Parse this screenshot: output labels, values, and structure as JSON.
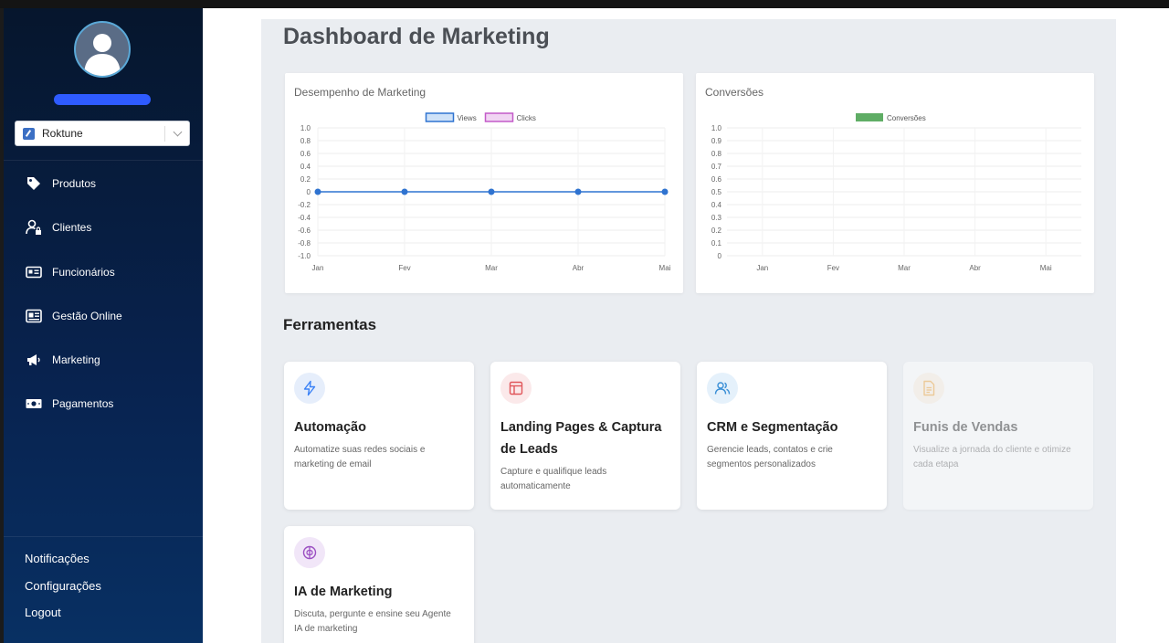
{
  "sidebar": {
    "store_select": {
      "value": "Roktune"
    },
    "nav": [
      {
        "label": "Produtos",
        "icon": "tag-icon"
      },
      {
        "label": "Clientes",
        "icon": "user-lock-icon"
      },
      {
        "label": "Funcionários",
        "icon": "id-card-icon"
      },
      {
        "label": "Gestão Online",
        "icon": "newspaper-icon"
      },
      {
        "label": "Marketing",
        "icon": "megaphone-icon"
      },
      {
        "label": "Pagamentos",
        "icon": "money-bill-icon"
      }
    ],
    "bottom": [
      {
        "label": "Notificações"
      },
      {
        "label": "Configurações"
      },
      {
        "label": "Logout"
      }
    ]
  },
  "main": {
    "title": "Dashboard de Marketing",
    "tools_title": "Ferramentas",
    "tools": [
      {
        "title": "Automação",
        "description": "Automatize suas redes sociais e marketing de email",
        "icon": "lightning-icon",
        "icon_color": "#3b82f6",
        "icon_bg": "#e6eefb",
        "enabled": true
      },
      {
        "title": "Landing Pages & Captura de Leads",
        "description": "Capture e qualifique leads automaticamente",
        "icon": "layout-icon",
        "icon_color": "#e0565b",
        "icon_bg": "#fbe9ea",
        "enabled": true
      },
      {
        "title": "CRM e Segmentação",
        "description": "Gerencie leads, contatos e crie segmentos personalizados",
        "icon": "users-icon",
        "icon_color": "#3a8fd6",
        "icon_bg": "#e5f1fb",
        "enabled": true
      },
      {
        "title": "Funis de Vendas",
        "description": "Visualize a jornada do cliente e otimize cada etapa",
        "icon": "document-icon",
        "icon_color": "#f0a030",
        "icon_bg": "#fdf1e0",
        "enabled": false
      },
      {
        "title": "IA de Marketing",
        "description": "Discuta, pergunte e ensine seu Agente IA de marketing",
        "icon": "brain-icon",
        "icon_color": "#9b4fc2",
        "icon_bg": "#f1e6f8",
        "enabled": true
      }
    ]
  },
  "chart_data": [
    {
      "type": "line",
      "title": "Desempenho de Marketing",
      "categories": [
        "Jan",
        "Fev",
        "Mar",
        "Abr",
        "Mai"
      ],
      "series": [
        {
          "name": "Views",
          "values": [
            0,
            0,
            0,
            0,
            0
          ],
          "color": "#2f73d0"
        },
        {
          "name": "Clicks",
          "values": [
            null,
            null,
            null,
            null,
            null
          ],
          "color": "#c35ac8"
        }
      ],
      "ylim": [
        -1.0,
        1.0
      ],
      "yticks": [
        "1.0",
        "0.8",
        "0.6",
        "0.4",
        "0.2",
        "0",
        "-0.2",
        "-0.4",
        "-0.6",
        "-0.8",
        "-1.0"
      ],
      "grid": true,
      "legend": "top-center"
    },
    {
      "type": "bar",
      "title": "Conversões",
      "categories": [
        "Jan",
        "Fev",
        "Mar",
        "Abr",
        "Mai"
      ],
      "series": [
        {
          "name": "Conversões",
          "values": [
            0,
            0,
            0,
            0,
            0
          ],
          "color": "#5fad65"
        }
      ],
      "ylim": [
        0,
        1.0
      ],
      "yticks": [
        "1.0",
        "0.9",
        "0.8",
        "0.7",
        "0.6",
        "0.5",
        "0.4",
        "0.3",
        "0.2",
        "0.1",
        "0"
      ],
      "grid": true,
      "legend": "top-center"
    }
  ]
}
